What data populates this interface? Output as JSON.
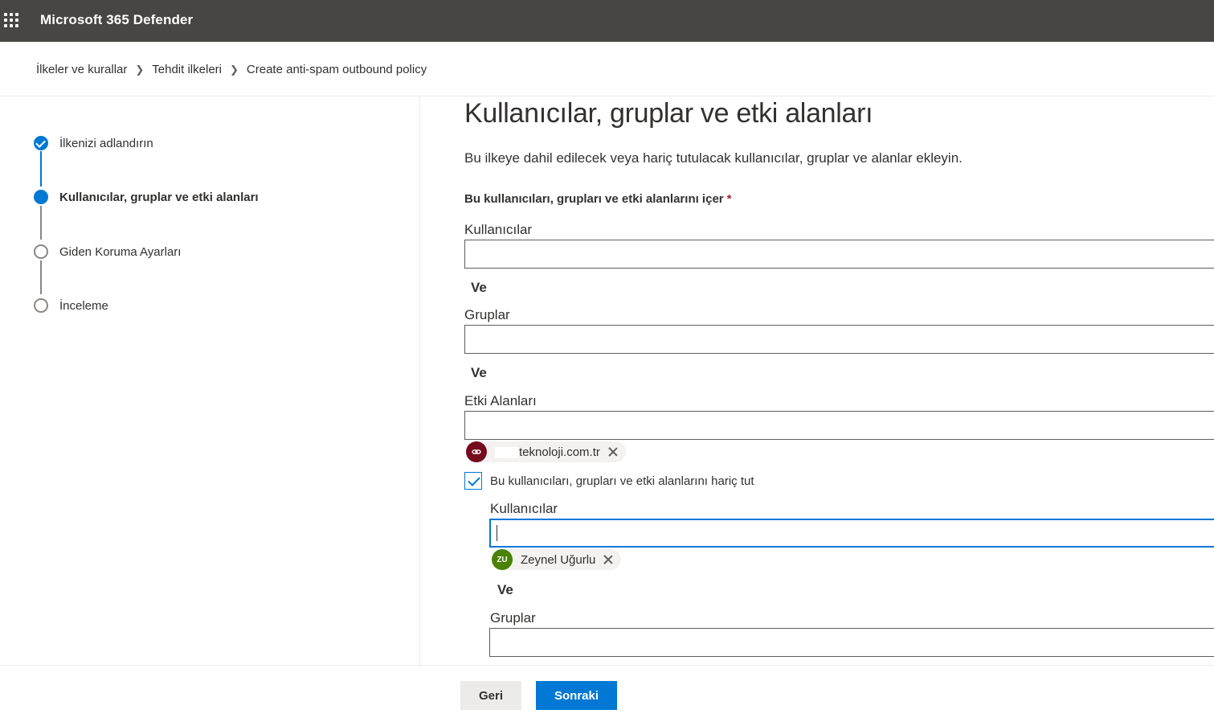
{
  "header": {
    "app_title": "Microsoft 365 Defender",
    "waffle_icon": "waffle-icon"
  },
  "breadcrumb": {
    "items": [
      "İlkeler ve kurallar",
      "Tehdit ilkeleri",
      "Create anti-spam outbound policy"
    ],
    "separator": ">"
  },
  "steps": [
    {
      "label": "İlkenizi adlandırın",
      "state": "done"
    },
    {
      "label": "Kullanıcılar, gruplar ve etki alanları",
      "state": "current"
    },
    {
      "label": "Giden Koruma Ayarları",
      "state": "todo"
    },
    {
      "label": "İnceleme",
      "state": "todo"
    }
  ],
  "main": {
    "title": "Kullanıcılar, gruplar ve etki alanları",
    "description": "Bu ilkeye dahil edilecek veya hariç tutulacak kullanıcılar, gruplar ve alanlar ekleyin.",
    "include_label": "Bu kullanıcıları, grupları ve etki alanlarını içer",
    "required_marker": "*",
    "and_label": "Ve",
    "include": {
      "users_label": "Kullanıcılar",
      "users_value": "",
      "groups_label": "Gruplar",
      "groups_value": "",
      "domains_label": "Etki Alanları",
      "domains_value": "",
      "domain_pill": {
        "text": "teknoloji.com.tr",
        "avatar_icon": "link-icon",
        "avatar_color": "#750b1c"
      }
    },
    "exclude": {
      "checkbox_label": "Bu kullanıcıları, grupları ve etki alanlarını hariç tut",
      "checked": true,
      "users_label": "Kullanıcılar",
      "users_value": "",
      "user_pill": {
        "initials": "ZU",
        "text": "Zeynel Uğurlu",
        "avatar_color": "#498205"
      },
      "groups_label": "Gruplar",
      "groups_value": ""
    }
  },
  "footer": {
    "back_label": "Geri",
    "next_label": "Sonraki"
  },
  "colors": {
    "accent": "#0078d4",
    "topbar": "#484644"
  }
}
